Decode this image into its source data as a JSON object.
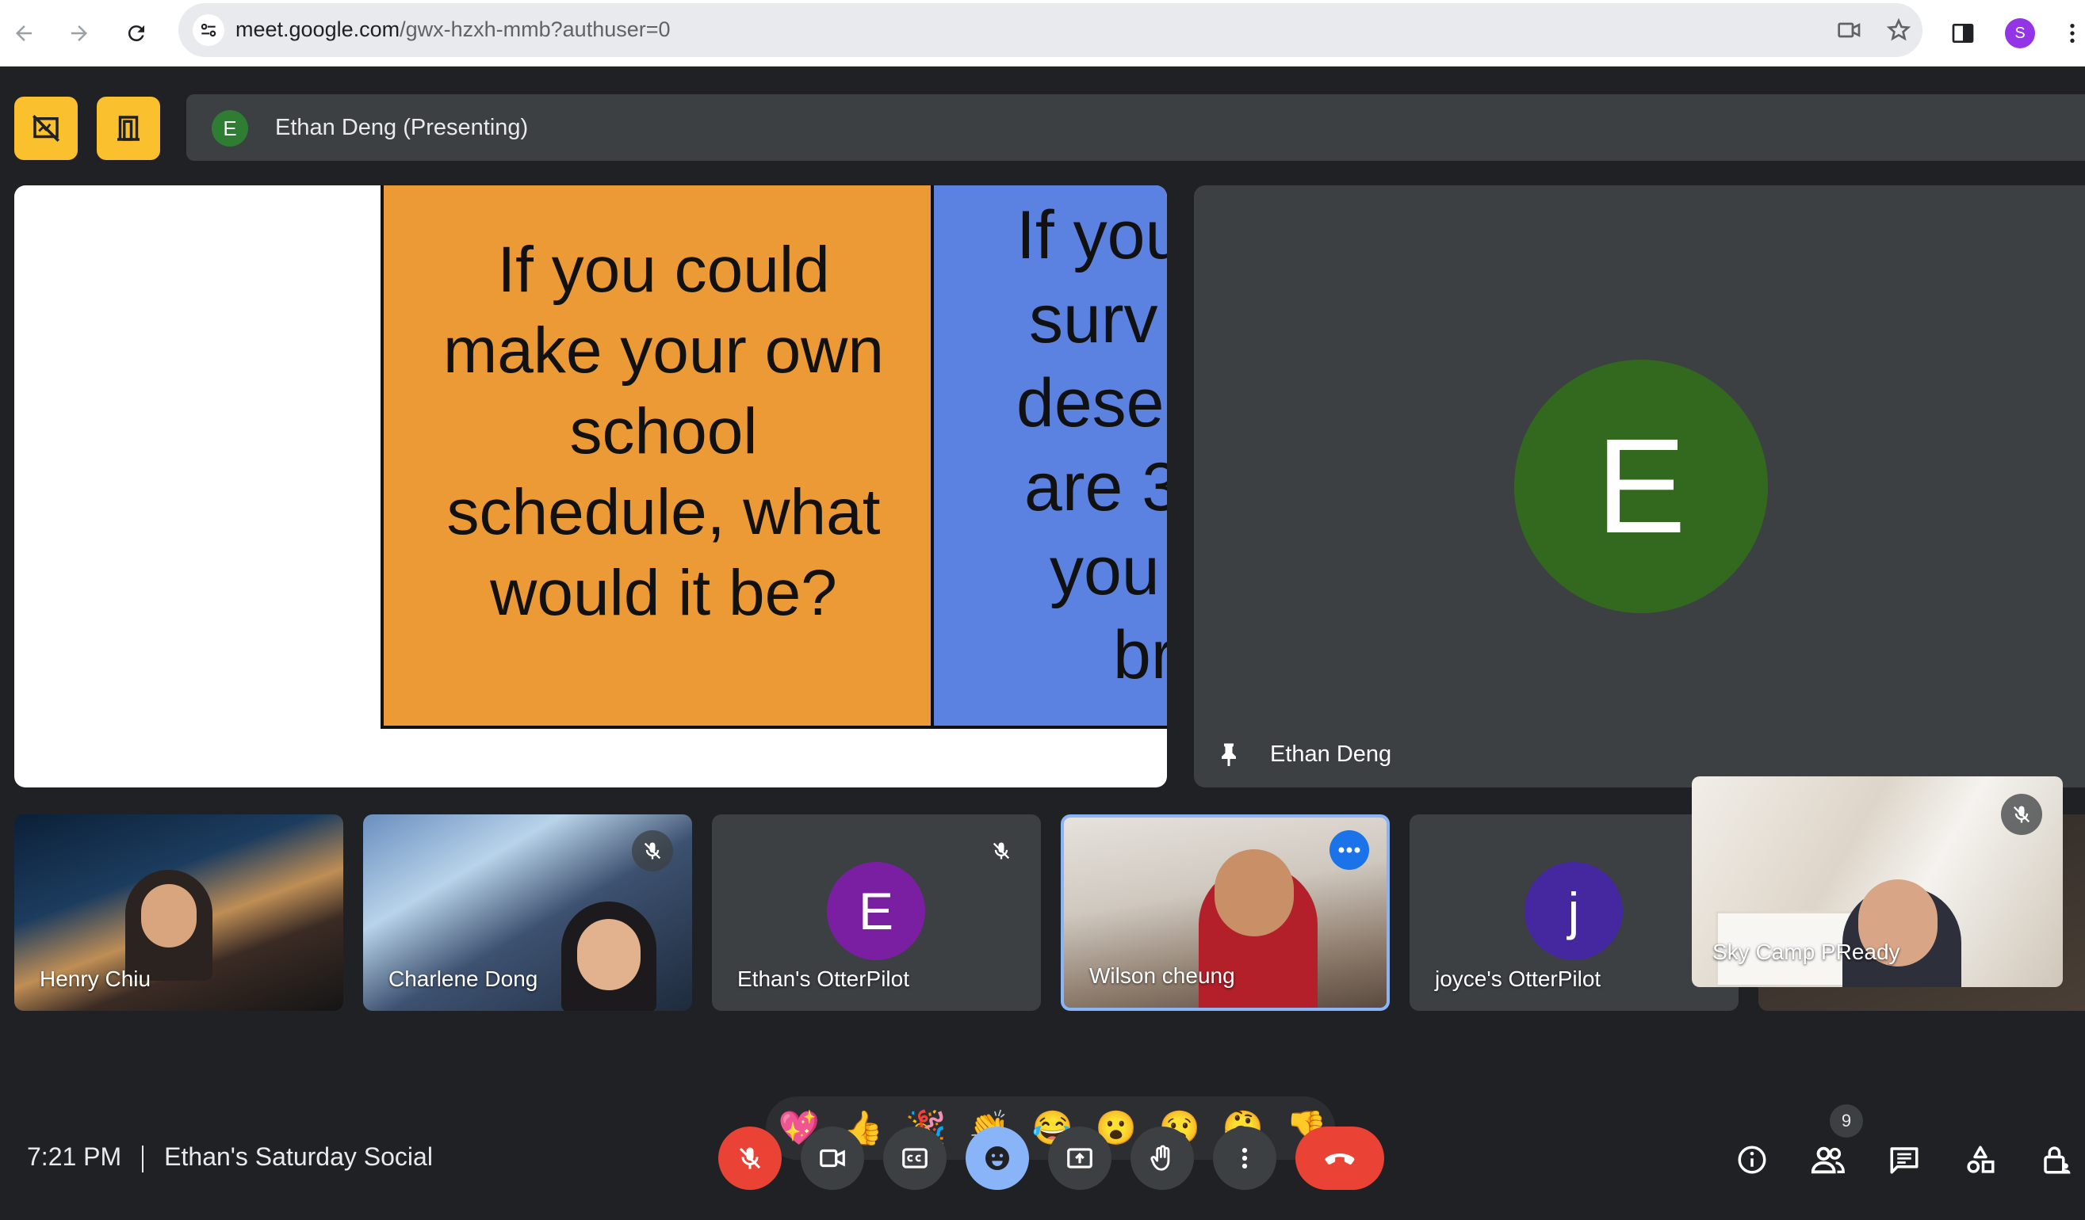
{
  "browser": {
    "url_host": "meet.google.com",
    "url_path": "/gwx-hzxh-mmb?authuser=0",
    "profile_initial": "S"
  },
  "meet": {
    "presenting_avatar": "E",
    "presenting_label": "Ethan Deng (Presenting)",
    "slide": {
      "orange_card": [
        "If you could",
        "make your own",
        "school",
        "schedule, what",
        "would it be?"
      ],
      "blue_card": [
        "If you",
        "surv",
        "dese",
        "are 3",
        "you",
        "br"
      ]
    },
    "speaker": {
      "avatar": "E",
      "name": "Ethan Deng"
    },
    "participants": [
      {
        "name": "Henry Chiu"
      },
      {
        "name": "Charlene Dong"
      },
      {
        "name": "Ethan's OtterPilot",
        "avatar": "E"
      },
      {
        "name": "Wilson cheung"
      },
      {
        "name": "joyce's OtterPilot",
        "avatar": "j"
      },
      {
        "name": "Sky Camp PReady"
      }
    ],
    "reactions": [
      "💖",
      "👍",
      "🎉",
      "👏",
      "😂",
      "😮",
      "😢",
      "🤔",
      "👎"
    ],
    "footer": {
      "time": "7:21 PM",
      "meeting_name": "Ethan's Saturday Social"
    },
    "people_count": "9",
    "colors": {
      "accent_yellow": "#fbc02d",
      "mic_off_red": "#ea4335",
      "active_blue": "#8ab4f8",
      "orange_card": "#ec9a35",
      "blue_card": "#5b82e0",
      "red_card": "#e0301e",
      "cyan_card": "#6ff8f8"
    }
  }
}
